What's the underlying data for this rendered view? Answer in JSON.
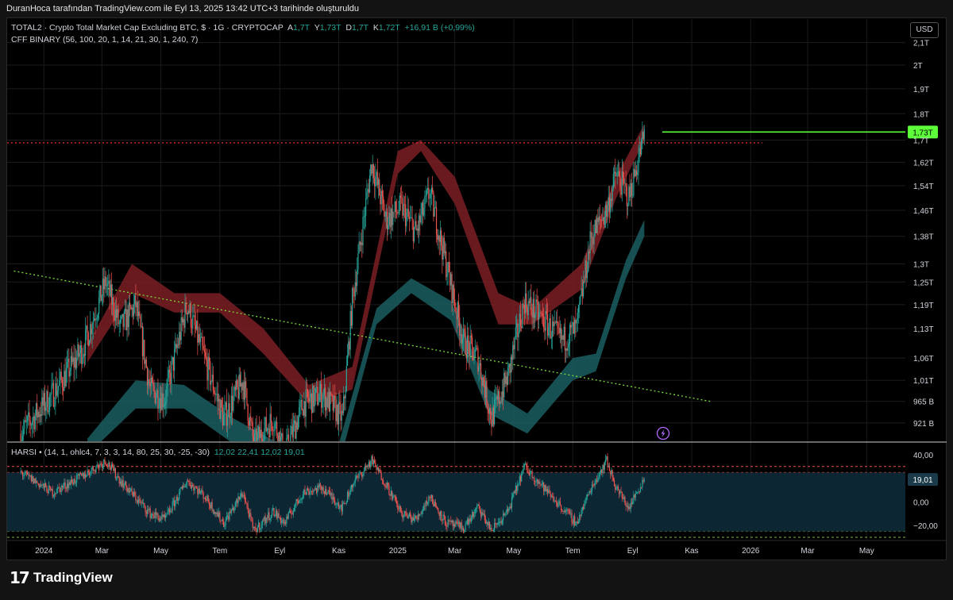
{
  "header": {
    "attribution": "DuranHoca tarafından TradingView.com ile Eyl 13, 2025 13:42 UTC+3 tarihinde oluşturuldu"
  },
  "legend": {
    "symbol": "TOTAL2 · Crypto Total Market Cap Excluding BTC, $ · 1G · CRYPTOCAP",
    "o_label": "A",
    "o_value": "1,7T",
    "h_label": "Y",
    "h_value": "1,73T",
    "l_label": "D",
    "l_value": "1,7T",
    "c_label": "K",
    "c_value": "1,72T",
    "change": "+16,91 B (+0,99%)",
    "indicator1": "CFF BINARY (56, 100, 20, 1, 14, 21, 30, 1, 240, 7)",
    "indicator2": "HARSI • (14, 1, ohlc4, 7, 3, 3, 14, 80, 25, 30, -25, -30)",
    "indicator2_values": "12,02  22,41  12,02  19,01"
  },
  "currency_button": "USD",
  "logo": {
    "text": "TradingView"
  },
  "colors": {
    "up": "#26a69a",
    "down": "#ef5350",
    "red_band": "#7a1f24",
    "teal_band": "#1b5e62",
    "last_price": "#5cff3a",
    "trend_line": "#7cdb3a",
    "resistance": "#ff3333"
  },
  "chart_data": [
    {
      "type": "candlestick",
      "title": "TOTAL2 · Crypto Total Market Cap Excluding BTC",
      "y_scale": "log",
      "y_tick_labels": [
        "2,1T",
        "2T",
        "1,9T",
        "1,8T",
        "1,7T",
        "1,62T",
        "1,54T",
        "1,46T",
        "1,38T",
        "1,3T",
        "1,25T",
        "1,19T",
        "1,13T",
        "1,06T",
        "1,01T",
        "965 B",
        "921 B"
      ],
      "y_ticks": [
        2.1,
        2.0,
        1.9,
        1.8,
        1.7,
        1.62,
        1.54,
        1.46,
        1.38,
        1.3,
        1.25,
        1.19,
        1.13,
        1.06,
        1.01,
        0.965,
        0.921
      ],
      "x_tick_labels": [
        "2024",
        "Mar",
        "May",
        "Tem",
        "Eyl",
        "Kas",
        "2025",
        "Mar",
        "May",
        "Tem",
        "Eyl",
        "Kas",
        "2026",
        "Mar",
        "May"
      ],
      "x_ticks": [
        "2024-01-01",
        "2024-03-01",
        "2024-05-01",
        "2024-07-01",
        "2024-09-01",
        "2024-11-01",
        "2025-01-01",
        "2025-03-01",
        "2025-05-01",
        "2025-07-01",
        "2025-09-01",
        "2025-11-01",
        "2026-01-01",
        "2026-03-01",
        "2026-05-01"
      ],
      "last_price": 1.73,
      "last_price_label": "1,73T",
      "resistance_level": 1.69,
      "close_path": [
        [
          "2023-12-08",
          0.9
        ],
        [
          "2024-01-10",
          0.98
        ],
        [
          "2024-02-10",
          1.08
        ],
        [
          "2024-03-05",
          1.25
        ],
        [
          "2024-03-20",
          1.13
        ],
        [
          "2024-04-05",
          1.19
        ],
        [
          "2024-04-20",
          0.99
        ],
        [
          "2024-05-05",
          0.97
        ],
        [
          "2024-05-28",
          1.19
        ],
        [
          "2024-06-15",
          1.06
        ],
        [
          "2024-07-05",
          0.93
        ],
        [
          "2024-07-25",
          1.01
        ],
        [
          "2024-08-05",
          0.88
        ],
        [
          "2024-08-25",
          0.93
        ],
        [
          "2024-09-06",
          0.86
        ],
        [
          "2024-09-25",
          0.96
        ],
        [
          "2024-10-15",
          0.98
        ],
        [
          "2024-11-05",
          0.93
        ],
        [
          "2024-11-15",
          1.2
        ],
        [
          "2024-12-05",
          1.62
        ],
        [
          "2024-12-20",
          1.43
        ],
        [
          "2025-01-05",
          1.47
        ],
        [
          "2025-01-20",
          1.39
        ],
        [
          "2025-02-03",
          1.52
        ],
        [
          "2025-02-20",
          1.3
        ],
        [
          "2025-03-10",
          1.1
        ],
        [
          "2025-03-25",
          1.06
        ],
        [
          "2025-04-08",
          0.93
        ],
        [
          "2025-04-25",
          1.02
        ],
        [
          "2025-05-12",
          1.2
        ],
        [
          "2025-06-01",
          1.15
        ],
        [
          "2025-06-20",
          1.1
        ],
        [
          "2025-07-05",
          1.13
        ],
        [
          "2025-07-20",
          1.38
        ],
        [
          "2025-08-05",
          1.46
        ],
        [
          "2025-08-15",
          1.58
        ],
        [
          "2025-08-28",
          1.5
        ],
        [
          "2025-09-13",
          1.72
        ]
      ],
      "red_band": [
        [
          "2024-02-15",
          1.05,
          1.09
        ],
        [
          "2024-04-01",
          1.22,
          1.3
        ],
        [
          "2024-05-15",
          1.17,
          1.22
        ],
        [
          "2024-07-01",
          1.17,
          1.22
        ],
        [
          "2024-08-15",
          1.07,
          1.13
        ],
        [
          "2024-10-01",
          0.96,
          1.0
        ],
        [
          "2024-11-15",
          0.99,
          1.04
        ],
        [
          "2025-01-01",
          1.58,
          1.66
        ],
        [
          "2025-01-25",
          1.66,
          1.7
        ],
        [
          "2025-03-01",
          1.48,
          1.57
        ],
        [
          "2025-04-15",
          1.14,
          1.22
        ],
        [
          "2025-05-20",
          1.14,
          1.18
        ],
        [
          "2025-07-10",
          1.23,
          1.3
        ],
        [
          "2025-08-15",
          1.5,
          1.57
        ],
        [
          "2025-09-13",
          1.7,
          1.76
        ]
      ],
      "teal_band": [
        [
          "2024-02-15",
          0.86,
          0.89
        ],
        [
          "2024-04-05",
          0.95,
          1.01
        ],
        [
          "2024-05-25",
          0.95,
          1.0
        ],
        [
          "2024-07-15",
          0.88,
          0.93
        ],
        [
          "2024-09-01",
          0.83,
          0.88
        ],
        [
          "2024-11-01",
          0.84,
          0.88
        ],
        [
          "2024-12-10",
          1.14,
          1.18
        ],
        [
          "2025-01-15",
          1.22,
          1.26
        ],
        [
          "2025-02-25",
          1.15,
          1.2
        ],
        [
          "2025-04-05",
          0.94,
          0.99
        ],
        [
          "2025-05-15",
          0.9,
          0.94
        ],
        [
          "2025-07-01",
          1.01,
          1.06
        ],
        [
          "2025-07-25",
          1.03,
          1.07
        ],
        [
          "2025-08-25",
          1.26,
          1.31
        ],
        [
          "2025-09-13",
          1.38,
          1.43
        ]
      ],
      "trend_line": [
        [
          "2023-12-01",
          1.28
        ],
        [
          "2025-11-20",
          0.965
        ]
      ]
    },
    {
      "type": "line",
      "title": "HARSI",
      "y_tick_labels": [
        "40,00",
        "0,00",
        "−20,00"
      ],
      "y_ticks": [
        40,
        0,
        -20
      ],
      "levels": [
        30,
        25,
        -25,
        -30
      ],
      "last_value": 19.01,
      "last_value_label": "19,01",
      "path": [
        [
          "2023-12-08",
          25
        ],
        [
          "2024-01-10",
          8
        ],
        [
          "2024-02-10",
          22
        ],
        [
          "2024-03-05",
          35
        ],
        [
          "2024-03-20",
          18
        ],
        [
          "2024-04-20",
          -10
        ],
        [
          "2024-05-05",
          -15
        ],
        [
          "2024-05-28",
          18
        ],
        [
          "2024-06-15",
          5
        ],
        [
          "2024-07-05",
          -18
        ],
        [
          "2024-07-25",
          8
        ],
        [
          "2024-08-05",
          -25
        ],
        [
          "2024-08-25",
          -8
        ],
        [
          "2024-09-06",
          -18
        ],
        [
          "2024-09-25",
          8
        ],
        [
          "2024-10-15",
          12
        ],
        [
          "2024-11-05",
          -5
        ],
        [
          "2024-11-15",
          15
        ],
        [
          "2024-12-05",
          35
        ],
        [
          "2024-12-20",
          15
        ],
        [
          "2025-01-05",
          -10
        ],
        [
          "2025-01-20",
          -15
        ],
        [
          "2025-02-03",
          5
        ],
        [
          "2025-02-20",
          -18
        ],
        [
          "2025-03-10",
          -22
        ],
        [
          "2025-03-25",
          -5
        ],
        [
          "2025-04-08",
          -24
        ],
        [
          "2025-04-25",
          -8
        ],
        [
          "2025-05-12",
          30
        ],
        [
          "2025-06-01",
          12
        ],
        [
          "2025-06-20",
          -5
        ],
        [
          "2025-07-05",
          -18
        ],
        [
          "2025-07-20",
          12
        ],
        [
          "2025-08-05",
          35
        ],
        [
          "2025-08-15",
          12
        ],
        [
          "2025-08-28",
          -5
        ],
        [
          "2025-09-13",
          20
        ]
      ]
    }
  ]
}
